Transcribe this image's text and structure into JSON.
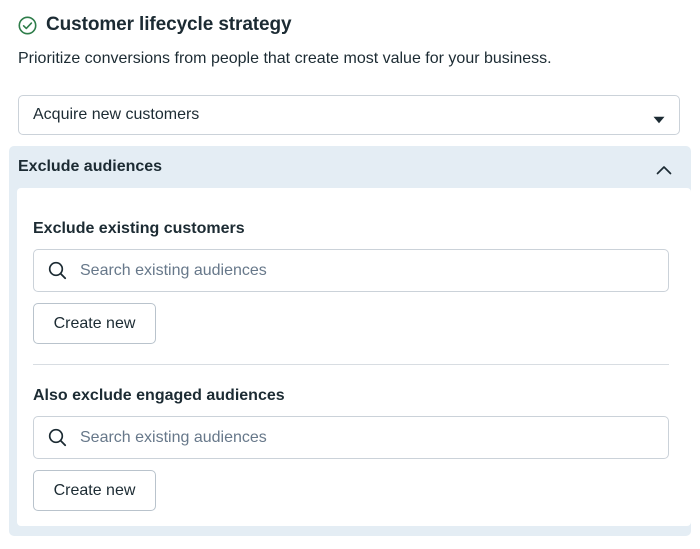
{
  "header": {
    "title": "Customer lifecycle strategy",
    "icon": "check-circle-icon",
    "icon_color": "#31a24c"
  },
  "subtitle": "Prioritize conversions from people that create most value for your business.",
  "strategy_select": {
    "value": "Acquire new customers",
    "icon": "caret-down-icon"
  },
  "exclude_panel": {
    "title": "Exclude audiences",
    "expanded": true,
    "icon": "chevron-up-icon",
    "background": "#e4edf4",
    "sections": [
      {
        "title": "Exclude existing customers",
        "search_placeholder": "Search existing audiences",
        "search_value": "",
        "button_label": "Create new"
      },
      {
        "title": "Also exclude engaged audiences",
        "search_placeholder": "Search existing audiences",
        "search_value": "",
        "button_label": "Create new"
      }
    ]
  }
}
